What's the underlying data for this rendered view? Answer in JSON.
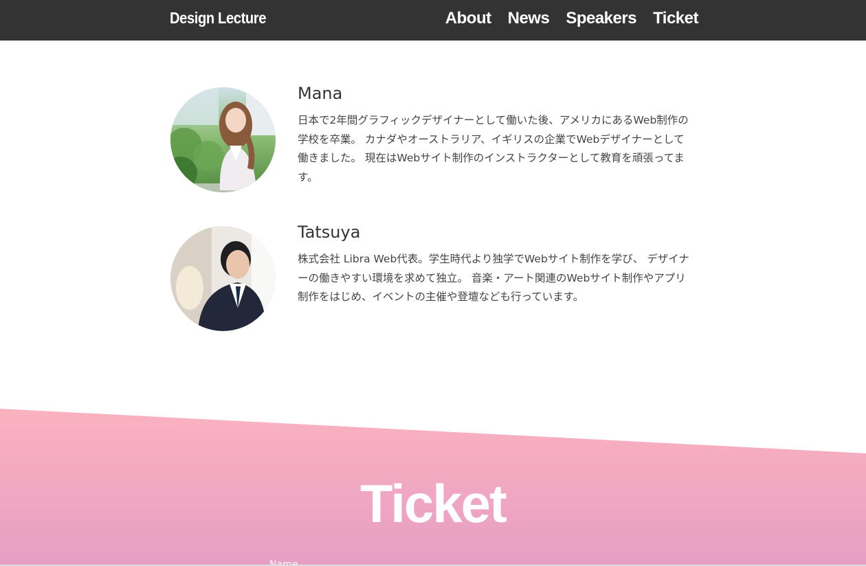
{
  "header": {
    "logo": "Design Lecture",
    "nav": [
      {
        "label": "About"
      },
      {
        "label": "News"
      },
      {
        "label": "Speakers"
      },
      {
        "label": "Ticket"
      }
    ]
  },
  "speakers": [
    {
      "name": "Mana",
      "bio": "日本で2年間グラフィックデザイナーとして働いた後、アメリカにあるWeb制作の学校を卒業。 カナダやオーストラリア、イギリスの企業でWebデザイナーとして働きました。 現在はWebサイト制作のインストラクターとして教育を頑張ってます。"
    },
    {
      "name": "Tatsuya",
      "bio": "株式会社 Libra Web代表。学生時代より独学でWebサイト制作を学び、 デザイナーの働きやすい環境を求めて独立。 音楽・アート関連のWebサイト制作やアプリ制作をはじめ、イベントの主催や登壇なども行っています。"
    }
  ],
  "ticket": {
    "title": "Ticket",
    "form_label": "Name",
    "colors": {
      "gradient_top": "#fbb2bf",
      "gradient_bottom": "#e69ec4"
    }
  },
  "colors": {
    "header_bg": "#333333",
    "text": "#333333"
  }
}
